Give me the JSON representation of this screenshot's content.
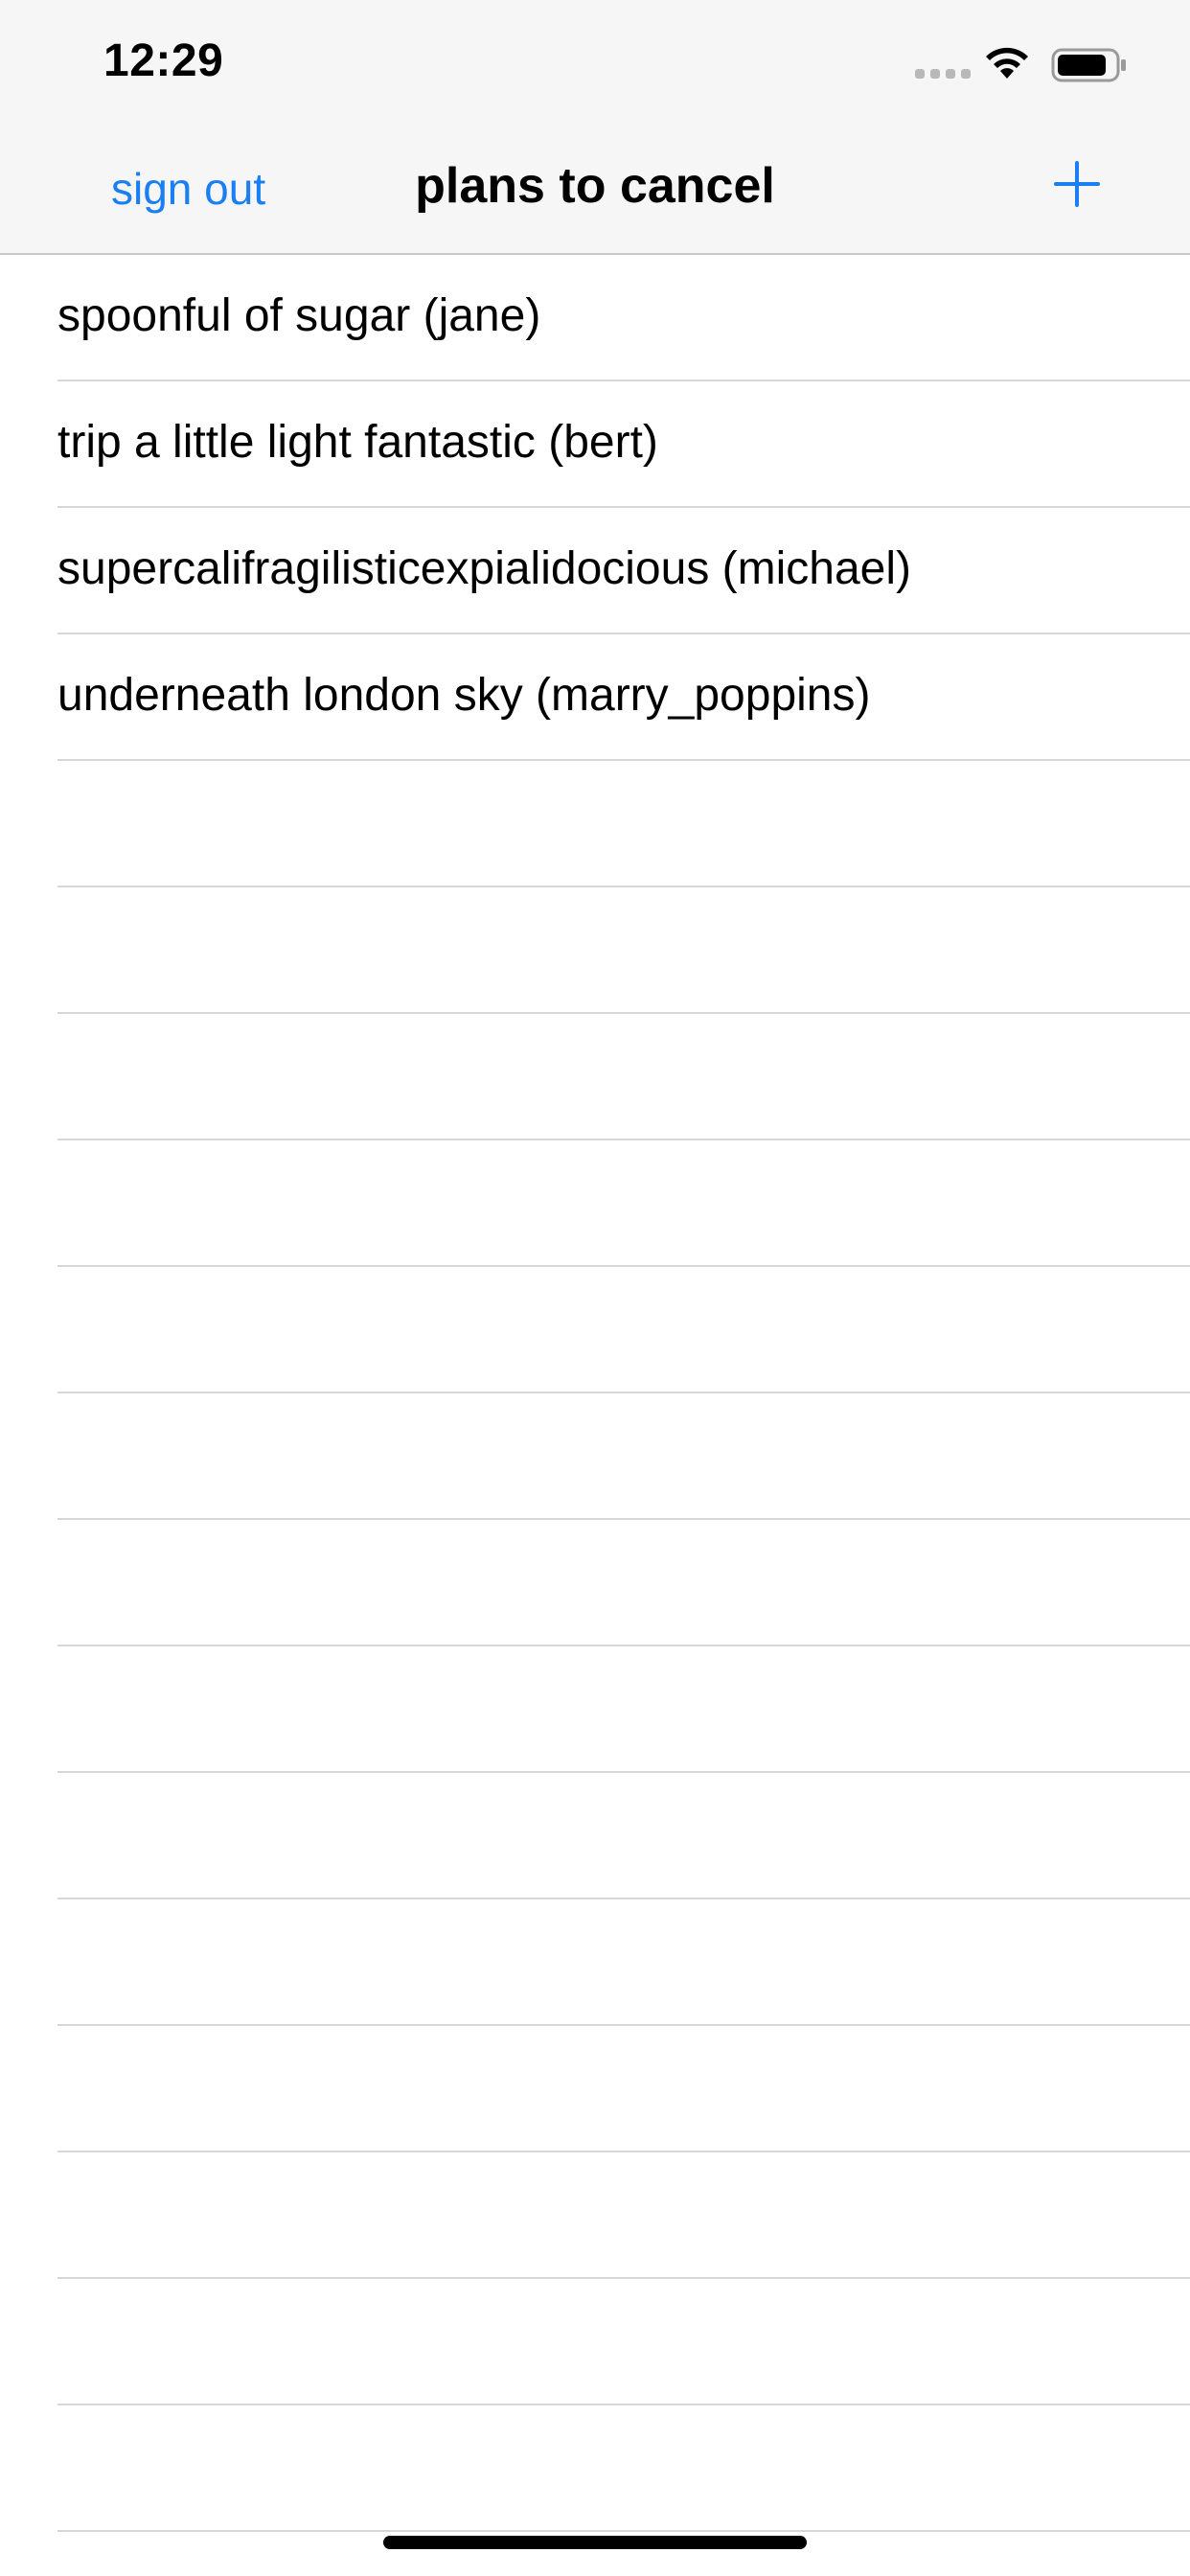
{
  "status_bar": {
    "time": "12:29",
    "icons": [
      "signal-dots-icon",
      "wifi-icon",
      "battery-icon"
    ]
  },
  "nav_bar": {
    "left_button_label": "sign out",
    "title": "plans to cancel",
    "right_button_icon": "plus-icon"
  },
  "colors": {
    "accent": "#1a7ff2",
    "separator": "#d6d6d9",
    "header_background": "#f6f6f6"
  },
  "plans": [
    {
      "label": "spoonful of sugar (jane)"
    },
    {
      "label": "trip a little light fantastic (bert)"
    },
    {
      "label": "supercalifragilisticexpialidocious (michael)"
    },
    {
      "label": "underneath london sky (marry_poppins)"
    }
  ]
}
